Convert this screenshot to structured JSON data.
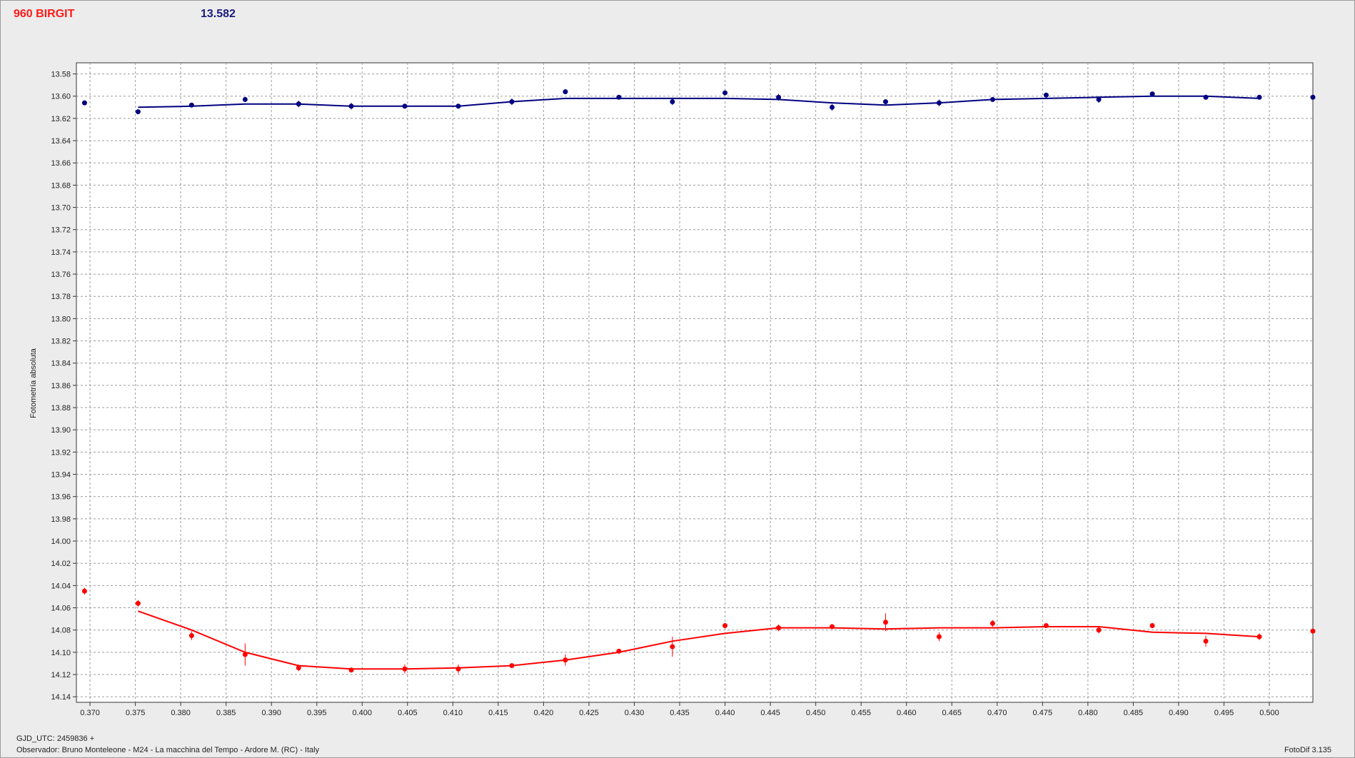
{
  "header": {
    "title": "960 BIRGIT",
    "ref_value": "13.582"
  },
  "footer": {
    "gjd": "GJD_UTC: 2459836 +",
    "observer": "Observador: Bruno Monteleone - M24 - La macchina del Tempo - Ardore M. (RC) - Italy",
    "version": "FotoDif 3.135"
  },
  "chart_data": {
    "type": "scatter",
    "ylabel": "Fotometría absoluta",
    "xlabel": "",
    "xlim": [
      0.3685,
      0.5048
    ],
    "ylim": [
      13.57,
      14.145
    ],
    "y_inverted": true,
    "grid": true,
    "x_ticks": [
      0.37,
      0.375,
      0.38,
      0.385,
      0.39,
      0.395,
      0.4,
      0.405,
      0.41,
      0.415,
      0.42,
      0.425,
      0.43,
      0.435,
      0.44,
      0.445,
      0.45,
      0.455,
      0.46,
      0.465,
      0.47,
      0.475,
      0.48,
      0.485,
      0.49,
      0.495,
      0.5
    ],
    "y_ticks": [
      13.58,
      13.6,
      13.62,
      13.64,
      13.66,
      13.68,
      13.7,
      13.72,
      13.74,
      13.76,
      13.78,
      13.8,
      13.82,
      13.84,
      13.86,
      13.88,
      13.9,
      13.92,
      13.94,
      13.96,
      13.98,
      14.0,
      14.02,
      14.04,
      14.06,
      14.08,
      14.1,
      14.12,
      14.14
    ],
    "series": [
      {
        "color": "#000080",
        "points": [
          {
            "x": 0.3694,
            "y": 13.606,
            "err": 0.002
          },
          {
            "x": 0.3753,
            "y": 13.614,
            "err": 0.002
          },
          {
            "x": 0.3812,
            "y": 13.608,
            "err": 0.002
          },
          {
            "x": 0.3871,
            "y": 13.603,
            "err": 0.002
          },
          {
            "x": 0.393,
            "y": 13.607,
            "err": 0.003
          },
          {
            "x": 0.3988,
            "y": 13.609,
            "err": 0.003
          },
          {
            "x": 0.4047,
            "y": 13.609,
            "err": 0.002
          },
          {
            "x": 0.4106,
            "y": 13.609,
            "err": 0.002
          },
          {
            "x": 0.4165,
            "y": 13.605,
            "err": 0.003
          },
          {
            "x": 0.4224,
            "y": 13.596,
            "err": 0.002
          },
          {
            "x": 0.4283,
            "y": 13.601,
            "err": 0.002
          },
          {
            "x": 0.4342,
            "y": 13.605,
            "err": 0.003
          },
          {
            "x": 0.44,
            "y": 13.597,
            "err": 0.002
          },
          {
            "x": 0.4459,
            "y": 13.601,
            "err": 0.003
          },
          {
            "x": 0.4518,
            "y": 13.61,
            "err": 0.003
          },
          {
            "x": 0.4577,
            "y": 13.605,
            "err": 0.002
          },
          {
            "x": 0.4636,
            "y": 13.606,
            "err": 0.003
          },
          {
            "x": 0.4695,
            "y": 13.603,
            "err": 0.002
          },
          {
            "x": 0.4754,
            "y": 13.599,
            "err": 0.002
          },
          {
            "x": 0.4812,
            "y": 13.603,
            "err": 0.003
          },
          {
            "x": 0.4871,
            "y": 13.598,
            "err": 0.002
          },
          {
            "x": 0.493,
            "y": 13.601,
            "err": 0.002
          },
          {
            "x": 0.4989,
            "y": 13.601,
            "err": 0.002
          },
          {
            "x": 0.5048,
            "y": 13.601,
            "err": 0.002
          }
        ],
        "fit": [
          [
            0.3753,
            13.61
          ],
          [
            0.3812,
            13.609
          ],
          [
            0.3871,
            13.607
          ],
          [
            0.393,
            13.607
          ],
          [
            0.3988,
            13.609
          ],
          [
            0.4047,
            13.609
          ],
          [
            0.4106,
            13.609
          ],
          [
            0.4165,
            13.605
          ],
          [
            0.4224,
            13.602
          ],
          [
            0.4283,
            13.602
          ],
          [
            0.4342,
            13.602
          ],
          [
            0.44,
            13.602
          ],
          [
            0.4459,
            13.603
          ],
          [
            0.4518,
            13.606
          ],
          [
            0.4577,
            13.608
          ],
          [
            0.4636,
            13.606
          ],
          [
            0.4695,
            13.603
          ],
          [
            0.4754,
            13.602
          ],
          [
            0.4812,
            13.601
          ],
          [
            0.4871,
            13.6
          ],
          [
            0.493,
            13.6
          ],
          [
            0.4989,
            13.602
          ]
        ]
      },
      {
        "color": "#ff0000",
        "points": [
          {
            "x": 0.3694,
            "y": 14.045,
            "err": 0.003
          },
          {
            "x": 0.3753,
            "y": 14.056,
            "err": 0.003
          },
          {
            "x": 0.3812,
            "y": 14.085,
            "err": 0.004
          },
          {
            "x": 0.3871,
            "y": 14.102,
            "err": 0.01
          },
          {
            "x": 0.393,
            "y": 14.114,
            "err": 0.003
          },
          {
            "x": 0.3988,
            "y": 14.116,
            "err": 0.002
          },
          {
            "x": 0.4047,
            "y": 14.115,
            "err": 0.004
          },
          {
            "x": 0.4106,
            "y": 14.115,
            "err": 0.004
          },
          {
            "x": 0.4165,
            "y": 14.112,
            "err": 0.002
          },
          {
            "x": 0.4224,
            "y": 14.107,
            "err": 0.005
          },
          {
            "x": 0.4283,
            "y": 14.099,
            "err": 0.002
          },
          {
            "x": 0.4342,
            "y": 14.095,
            "err": 0.009
          },
          {
            "x": 0.44,
            "y": 14.076,
            "err": 0.002
          },
          {
            "x": 0.4459,
            "y": 14.078,
            "err": 0.003
          },
          {
            "x": 0.4518,
            "y": 14.077,
            "err": 0.002
          },
          {
            "x": 0.4577,
            "y": 14.073,
            "err": 0.008
          },
          {
            "x": 0.4636,
            "y": 14.086,
            "err": 0.004
          },
          {
            "x": 0.4695,
            "y": 14.074,
            "err": 0.003
          },
          {
            "x": 0.4754,
            "y": 14.076,
            "err": 0.002
          },
          {
            "x": 0.4812,
            "y": 14.08,
            "err": 0.003
          },
          {
            "x": 0.4871,
            "y": 14.076,
            "err": 0.002
          },
          {
            "x": 0.493,
            "y": 14.09,
            "err": 0.005
          },
          {
            "x": 0.4989,
            "y": 14.086,
            "err": 0.003
          },
          {
            "x": 0.5048,
            "y": 14.081,
            "err": 0.002
          }
        ],
        "fit": [
          [
            0.3753,
            14.063
          ],
          [
            0.3812,
            14.08
          ],
          [
            0.3871,
            14.1
          ],
          [
            0.393,
            14.112
          ],
          [
            0.3988,
            14.115
          ],
          [
            0.4047,
            14.115
          ],
          [
            0.4106,
            14.114
          ],
          [
            0.4165,
            14.112
          ],
          [
            0.4224,
            14.107
          ],
          [
            0.4283,
            14.1
          ],
          [
            0.4342,
            14.09
          ],
          [
            0.44,
            14.083
          ],
          [
            0.4459,
            14.078
          ],
          [
            0.4518,
            14.078
          ],
          [
            0.4577,
            14.079
          ],
          [
            0.4636,
            14.078
          ],
          [
            0.4695,
            14.078
          ],
          [
            0.4754,
            14.077
          ],
          [
            0.4812,
            14.077
          ],
          [
            0.4871,
            14.082
          ],
          [
            0.493,
            14.083
          ],
          [
            0.4989,
            14.086
          ]
        ]
      }
    ]
  }
}
